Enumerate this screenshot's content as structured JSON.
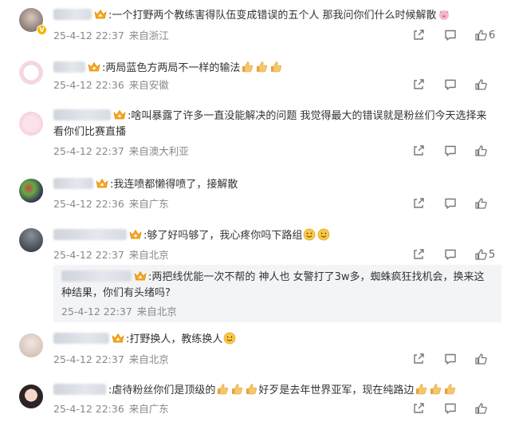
{
  "comments": [
    {
      "user": "户…",
      "text": ":一个打野两个教练害得队伍变成错误的五个人 那我问你们什么时候解散",
      "time": "25-4-12 22:37",
      "location": "来自浙江",
      "likes": "6"
    },
    {
      "user": "挥…",
      "text": ":两局蓝色方两局不一样的输法",
      "time": "25-4-12 22:36",
      "location": "来自安徽",
      "likes": ""
    },
    {
      "user": "只…口",
      "text": ":啥叫暴露了许多一直没能解决的问题 我觉得最大的错误就是粉丝们今天选择来看你们比赛直播",
      "time": "25-4-12 22:37",
      "location": "来自澳大利亚",
      "likes": ""
    },
    {
      "user": "…见",
      "text": ":我连喷都懒得喷了，接解散",
      "time": "25-4-12 22:36",
      "location": "来自广东",
      "likes": ""
    },
    {
      "user": "林…话",
      "text": ":够了好吗够了，我心疼你吗下路组",
      "time": "25-4-12 22:37",
      "location": "来自北京",
      "likes": "5"
    },
    {
      "user": "林…话",
      "text": ":两把线优能一次不帮的 神人也 女警打了3w多，蜘蛛疯狂找机会，换来这种结果，你们有头绪吗?",
      "time": "25-4-12 22:37",
      "location": "来自北京",
      "likes": ""
    },
    {
      "user": "…_",
      "text": ":打野换人，教练换人",
      "time": "25-4-12 22:37",
      "location": "来自北京",
      "likes": ""
    },
    {
      "user": "中…道",
      "text": ":虐待粉丝你们是顶级的",
      "text2": "好歹是去年世界亚军，现在纯路边",
      "time": "25-4-12 22:36",
      "location": "来自广东",
      "likes": ""
    }
  ],
  "icons": {
    "share": "share-icon",
    "comment": "comment-icon",
    "like": "thumbs-up-icon"
  }
}
